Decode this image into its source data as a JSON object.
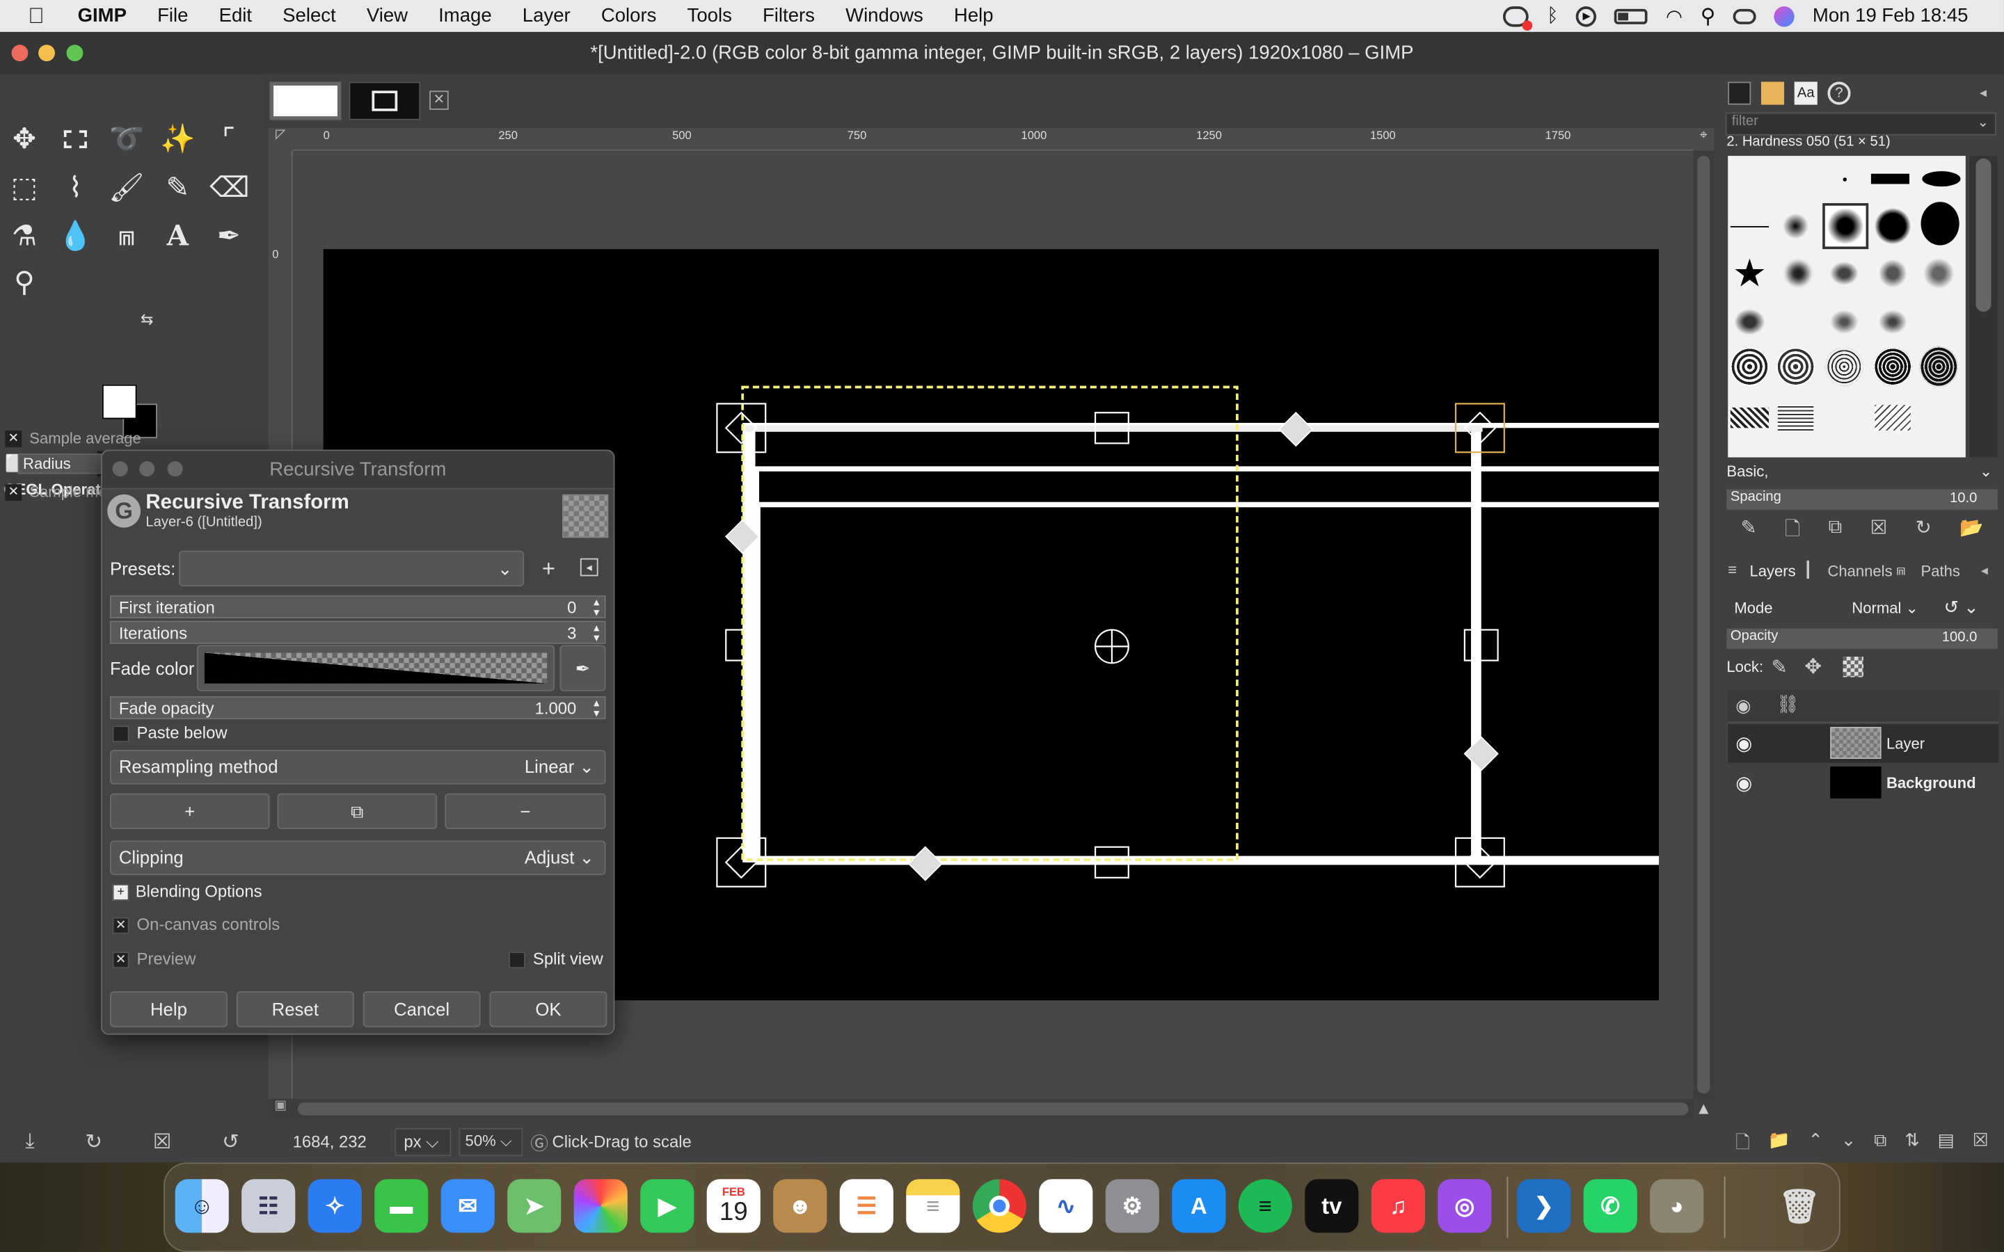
{
  "menubar": {
    "apple_icon": "apple-icon",
    "app_name": "GIMP",
    "items": [
      "File",
      "Edit",
      "Select",
      "View",
      "Image",
      "Layer",
      "Colors",
      "Tools",
      "Filters",
      "Windows",
      "Help"
    ],
    "clock": "Mon 19 Feb  18:45"
  },
  "window": {
    "title": "*[Untitled]-2.0 (RGB color 8-bit gamma integer, GIMP built-in sRGB, 2 layers) 1920x1080 – GIMP"
  },
  "toolbox": {
    "tools": [
      "move-tool-icon",
      "rect-select-tool-icon",
      "lasso-tool-icon",
      "fuzzy-select-tool-icon",
      "crop-tool-icon",
      "unified-transform-tool-icon",
      "warp-transform-tool-icon",
      "bucket-fill-tool-icon",
      "paintbrush-tool-icon",
      "eraser-tool-icon",
      "clone-tool-icon",
      "smudge-tool-icon",
      "paths-tool-icon",
      "text-tool-icon",
      "color-picker-tool-icon",
      "zoom-tool-icon"
    ],
    "fg_color": "#ffffff",
    "bg_color": "#000000",
    "tool_options_title": "GEGL Operation",
    "opt_sample_average": "Sample average",
    "opt_radius": "Radius",
    "opt_sample_merged": "Sample me"
  },
  "ruler": {
    "marks": [
      "0",
      "250",
      "500",
      "750",
      "1000",
      "1250",
      "1500",
      "1750"
    ],
    "vmarks": [
      "0"
    ]
  },
  "statusbar": {
    "coords": "1684, 232",
    "unit": "px",
    "zoom": "50%",
    "message": "Click-Drag to scale"
  },
  "dialog": {
    "window_title": "Recursive Transform",
    "heading": "Recursive Transform",
    "subheading": "Layer-6 ([Untitled])",
    "presets_label": "Presets:",
    "first_iteration_label": "First iteration",
    "first_iteration_value": "0",
    "iterations_label": "Iterations",
    "iterations_value": "3",
    "fade_color_label": "Fade color",
    "fade_opacity_label": "Fade opacity",
    "fade_opacity_value": "1.000",
    "paste_below_label": "Paste below",
    "resampling_label": "Resampling method",
    "resampling_value": "Linear",
    "clipping_label": "Clipping",
    "clipping_value": "Adjust",
    "blending_label": "Blending Options",
    "oncanvas_label": "On-canvas controls",
    "preview_label": "Preview",
    "splitview_label": "Split view",
    "buttons": {
      "help": "Help",
      "reset": "Reset",
      "cancel": "Cancel",
      "ok": "OK"
    }
  },
  "brushes": {
    "filter_placeholder": "filter",
    "selected_brush": "2. Hardness 050 (51 × 51)",
    "tag": "Basic,",
    "spacing_label": "Spacing",
    "spacing_value": "10.0"
  },
  "layers": {
    "tabs": [
      "Layers",
      "Channels",
      "Paths"
    ],
    "mode_label": "Mode",
    "mode_value": "Normal",
    "opacity_label": "Opacity",
    "opacity_value": "100.0",
    "lock_label": "Lock:",
    "items": [
      {
        "name": "Layer"
      },
      {
        "name": "Background"
      }
    ]
  },
  "dock": {
    "apps": [
      "Finder",
      "Launchpad",
      "Safari",
      "Messages",
      "Mail",
      "Maps",
      "Photos",
      "FaceTime",
      "Calendar",
      "Contacts",
      "Reminders",
      "Notes",
      "Chrome",
      "Freeform",
      "System Settings",
      "App Store",
      "Spotify",
      "Apple TV",
      "Music",
      "Podcasts",
      "VS Code",
      "WhatsApp",
      "GIMP",
      "Trash"
    ],
    "calendar_month": "FEB",
    "calendar_day": "19",
    "tv_label": "tv"
  }
}
